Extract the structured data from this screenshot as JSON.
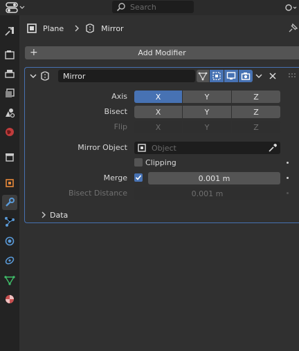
{
  "search": {
    "placeholder": "Search"
  },
  "breadcrumb": {
    "object": "Plane",
    "modifier": "Mirror"
  },
  "add_modifier": {
    "label": "Add Modifier"
  },
  "modifier": {
    "name": "Mirror",
    "axis": {
      "label": "Axis",
      "x": "X",
      "y": "Y",
      "z": "Z",
      "active": "X"
    },
    "bisect": {
      "label": "Bisect",
      "x": "X",
      "y": "Y",
      "z": "Z"
    },
    "flip": {
      "label": "Flip",
      "x": "X",
      "y": "Y",
      "z": "Z"
    },
    "mirror_object": {
      "label": "Mirror Object",
      "placeholder": "Object"
    },
    "clipping": {
      "label": "Clipping",
      "checked": false
    },
    "merge": {
      "label": "Merge",
      "checked": true,
      "value": "0.001 m"
    },
    "bisect_distance": {
      "label": "Bisect Distance",
      "value": "0.001 m"
    },
    "data_panel": {
      "label": "Data"
    }
  },
  "colors": {
    "accent": "#4772b3",
    "panel_border": "#4772b3",
    "background": "#303030"
  }
}
